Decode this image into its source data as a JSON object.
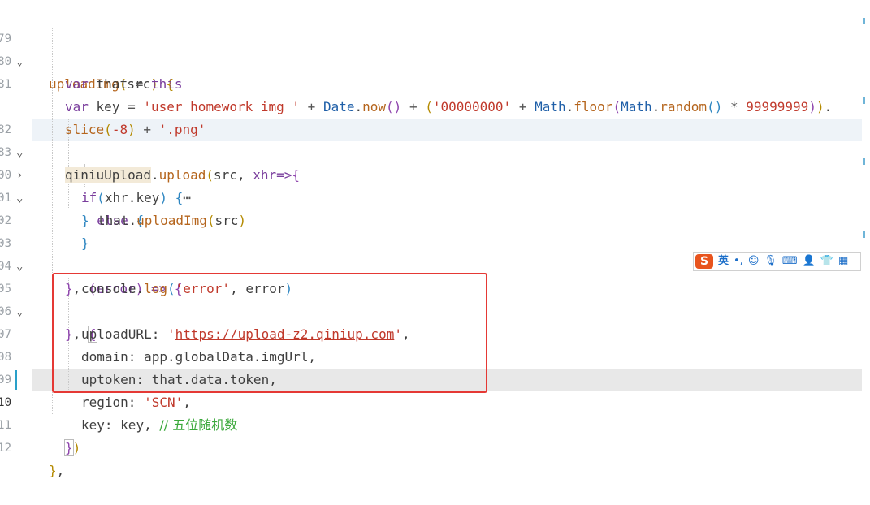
{
  "line_numbers": [
    "79",
    "80",
    "81",
    "",
    "82",
    "83",
    "00",
    "01",
    "02",
    "03",
    "04",
    "05",
    "06",
    "07",
    "08",
    "09",
    "10",
    "11",
    "12"
  ],
  "code": {
    "l79_fn": "uploadImg",
    "l79_arg": "src",
    "l80_kw": "var",
    "l80_name": "that",
    "l80_this": "this",
    "l81_kw": "var",
    "l81_name": "key",
    "l81_str": "'user_homework_img_'",
    "l81_date": "Date",
    "l81_now": "now",
    "l81_zeros": "'00000000'",
    "l81_math1": "Math",
    "l81_floor": "floor",
    "l81_math2": "Math",
    "l81_random": "random",
    "l81_num": "99999999",
    "l81b_slice": "slice",
    "l81b_num": "-8",
    "l81b_ext": "'.png'",
    "l82_obj": "qiniuUpload",
    "l82_fn": "upload",
    "l82_arg": "src",
    "l82_cb": "xhr",
    "l83_if": "if",
    "l83_cond": "xhr.key",
    "l83_fold": "⋯",
    "l00_else": "else",
    "l01_that": "that",
    "l01_fn": "uploadImg",
    "l01_arg": "src",
    "l03_err": "error",
    "l04_console": "console",
    "l04_log": "log",
    "l04_str": "'error'",
    "l04_arg": "error",
    "l06_key": "uploadURL",
    "l06_q1": "'",
    "l06_url": "https://upload-z2.qiniup.com",
    "l06_q2": "'",
    "l07_key": "domain",
    "l07_val": "app.globalData.imgUrl",
    "l08_key": "uptoken",
    "l08_val": "that.data.token",
    "l09_key": "region",
    "l09_val": "'SCN'",
    "l10_key": "key",
    "l10_val": "key",
    "l10_comment": "// 五位随机数"
  },
  "ime_toolbar": {
    "logo": "S",
    "lang": "英",
    "punct": "•,",
    "icons": [
      "smile-icon",
      "mic-icon",
      "keyboard-icon",
      "person-icon",
      "shirt-icon",
      "grid-icon"
    ]
  },
  "colors": {
    "keyword": "#7a3e9d",
    "string": "#c0392b",
    "comment": "#3aa83a",
    "highlight_box": "#e53935"
  }
}
